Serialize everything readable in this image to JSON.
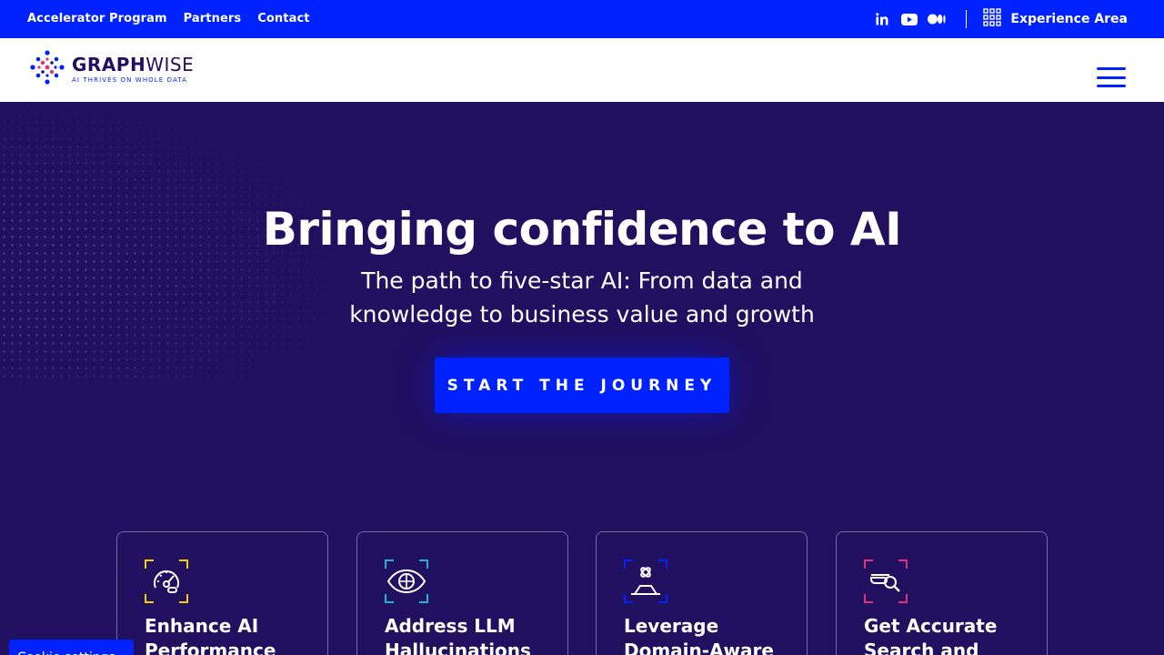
{
  "topbar": {
    "links": [
      "Accelerator Program",
      "Partners",
      "Contact"
    ],
    "social": [
      "linkedin-icon",
      "youtube-icon",
      "medium-icon"
    ],
    "experience_label": "Experience Area",
    "bg_color": "#0022ff"
  },
  "header": {
    "logo_bold": "GRAPH",
    "logo_thin": "WISE",
    "logo_tagline": "AI THRIVES ON WHOLE DATA"
  },
  "hero": {
    "title": "Bringing confidence to AI",
    "subtitle": "The path to five-star AI: From data and knowledge to business value and growth",
    "cta": "START THE JOURNEY",
    "bg_color": "#210f5f"
  },
  "cards": [
    {
      "title": "Enhance AI Performance",
      "icon": "speedometer-icon",
      "accent": "#f5d000"
    },
    {
      "title": "Address LLM Hallucinations",
      "icon": "eye-icon",
      "accent": "#1fb8c4"
    },
    {
      "title": "Leverage Domain-Aware",
      "icon": "hand-atom-icon",
      "accent": "#0022ff"
    },
    {
      "title": "Get Accurate Search and",
      "icon": "search-document-icon",
      "accent": "#e0327d"
    }
  ],
  "cookie": {
    "label": "Cookie settings"
  }
}
